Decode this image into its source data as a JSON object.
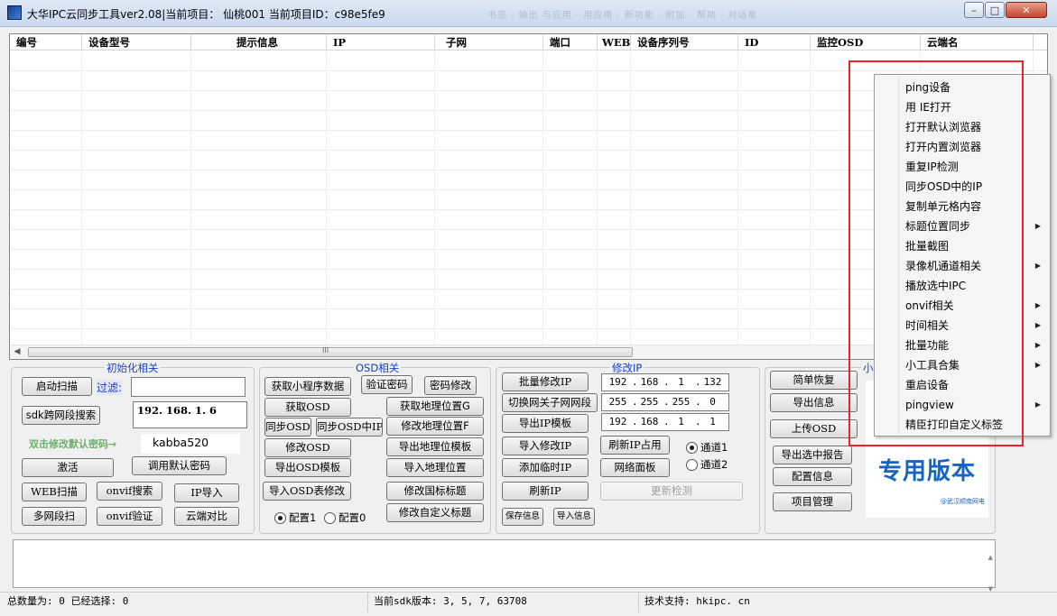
{
  "window": {
    "title": "大华IPC云同步工具ver2.08|当前项目： 仙桃001  当前项目ID：c98e5fe9",
    "blurred_toolbar_text": "书签   · 输出 与应用   · 用应用   · 新功能   · 附加   · 帮助   · 对话框",
    "controls": {
      "minimize": "–",
      "maximize": "□",
      "close": "✕"
    }
  },
  "grid": {
    "columns": [
      "编号",
      "设备型号",
      "提示信息",
      "IP",
      "子网",
      "端口",
      "WEB",
      "设备序列号",
      "ID",
      "监控OSD",
      "云端名"
    ],
    "rows": [],
    "scroll_grip": "III"
  },
  "init_group": {
    "title": "初始化相关",
    "start_scan": "启动扫描",
    "filter_label": "过滤:",
    "filter_value": "",
    "sdk_search": "sdk跨网段搜索",
    "ip_value": "192. 168. 1. 6",
    "hint": "双击修改默认密码→",
    "password": "kabba520",
    "activate": "激活",
    "default_pwd": "调用默认密码",
    "web_scan": "WEB扫描",
    "onvif_search": "onvif搜索",
    "ip_import": "IP导入",
    "multi_segment": "多网段扫",
    "onvif_verify": "onvif验证",
    "cloud_compare": "云端对比"
  },
  "osd_group": {
    "title": "OSD相关",
    "get_mini_data": "获取小程序数据",
    "verify_pwd": "验证密码",
    "pwd_modify": "密码修改",
    "get_osd": "获取OSD",
    "get_geo": "获取地理位置G",
    "sync_osd": "同步OSD",
    "sync_osd_ip": "同步OSD中IP",
    "modify_geo": "修改地理位置F",
    "modify_osd": "修改OSD",
    "export_geo_tpl": "导出地理位模板",
    "export_osd_tpl": "导出OSD模板",
    "import_geo": "导入地理位置",
    "import_osd_table": "导入OSD表修改",
    "modify_gb_title": "修改国标标题",
    "config1": "配置1",
    "config0": "配置0",
    "modify_custom_title": "修改自定义标题"
  },
  "ip_group": {
    "title": "修改IP",
    "batch_modify": "批量修改IP",
    "ip": [
      "192",
      "168",
      "1",
      "132"
    ],
    "switch_gw": "切换网关子网网段",
    "mask": [
      "255",
      "255",
      "255",
      "0"
    ],
    "export_tpl": "导出IP模板",
    "gateway": [
      "192",
      "168",
      "1",
      "1"
    ],
    "import_modify": "导入修改IP",
    "refresh_ip_use": "刷新IP占用",
    "channel1": "通道1",
    "add_temp_ip": "添加临时IP",
    "network_panel": "网络面板",
    "channel2": "通道2",
    "refresh_ip": "刷新IP",
    "update_check": "更新检测",
    "save_info": "保存信息",
    "import_info": "导入信息"
  },
  "misc_group": {
    "title": "小",
    "simple_restore": "简单恢复",
    "export_info": "导出信息",
    "upload_osd": "上传OSD",
    "export_report": "导出选中报告",
    "config_info": "配置信息",
    "project_manage": "项目管理"
  },
  "logo": {
    "main": "专用版本",
    "sub": "@武汉顺南网电"
  },
  "status": {
    "count": "总数量为: 0 已经选择: 0",
    "sdk": "当前sdk版本: 3, 5, 7, 63708",
    "support": "技术支持: hkipc. cn"
  },
  "context_menu": [
    {
      "label": "ping设备",
      "submenu": false
    },
    {
      "label": "用 IE打开",
      "submenu": false
    },
    {
      "label": "打开默认浏览器",
      "submenu": false
    },
    {
      "label": "打开内置浏览器",
      "submenu": false
    },
    {
      "label": "重复IP检测",
      "submenu": false
    },
    {
      "label": "同步OSD中的IP",
      "submenu": false
    },
    {
      "label": "复制单元格内容",
      "submenu": false
    },
    {
      "label": "标题位置同步",
      "submenu": true
    },
    {
      "label": "批量截图",
      "submenu": false
    },
    {
      "label": "录像机通道相关",
      "submenu": true
    },
    {
      "label": "播放选中IPC",
      "submenu": false
    },
    {
      "label": "onvif相关",
      "submenu": true
    },
    {
      "label": "时间相关",
      "submenu": true
    },
    {
      "label": "批量功能",
      "submenu": true
    },
    {
      "label": "小工具合集",
      "submenu": true
    },
    {
      "label": "重启设备",
      "submenu": false
    },
    {
      "label": "pingview",
      "submenu": true
    },
    {
      "label": "精臣打印自定义标签",
      "submenu": false
    }
  ],
  "colors": {
    "group_title": "#1740c8",
    "highlight": "#e8262a",
    "logo": "#1565c0"
  }
}
